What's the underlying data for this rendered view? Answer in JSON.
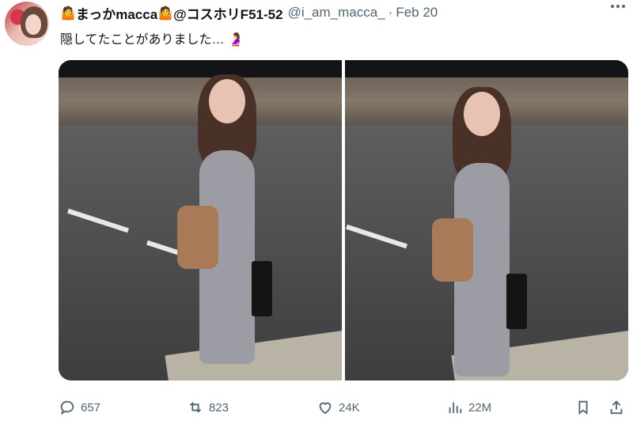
{
  "author": {
    "prefix_emoji": "🤷",
    "display_name": "まっかmacca",
    "name_emoji": "🤷",
    "handle_text": "@コスホリF51-52",
    "username": "@i_am_macca_",
    "separator": "·",
    "date": "Feb 20"
  },
  "tweet": {
    "text": "隠してたことがありました…",
    "text_emoji": "🤰"
  },
  "stats": {
    "replies": "657",
    "reposts": "823",
    "likes": "24K",
    "views": "22M"
  },
  "icons": {
    "reply": "reply-icon",
    "repost": "repost-icon",
    "like": "heart-icon",
    "views": "views-icon",
    "bookmark": "bookmark-icon",
    "share": "share-icon",
    "more": "more-icon"
  }
}
